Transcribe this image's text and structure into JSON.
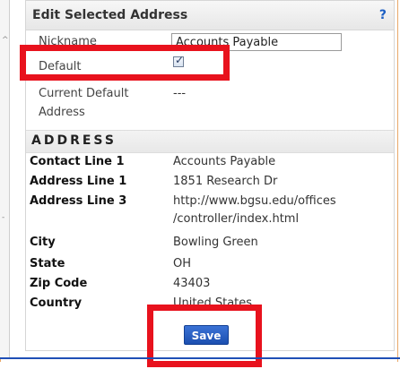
{
  "panel": {
    "title": "Edit Selected Address",
    "help": "?"
  },
  "fields": {
    "nickname_label": "Nickname",
    "nickname_value": "Accounts Payable",
    "default_label": "Default",
    "default_checked": true,
    "current_default_label_line1": "Current Default",
    "current_default_label_line2": "Address",
    "current_default_value": "---"
  },
  "address": {
    "section_title": "ADDRESS",
    "contact_line1_label": "Contact Line 1",
    "contact_line1_value": "Accounts Payable",
    "address_line1_label": "Address Line 1",
    "address_line1_value": "1851 Research Dr",
    "address_line3_label": "Address Line 3",
    "address_line3_value_line1": "http://www.bgsu.edu/offices",
    "address_line3_value_line2": "/controller/index.html",
    "city_label": "City",
    "city_value": "Bowling Green",
    "state_label": "State",
    "state_value": "OH",
    "zip_label": "Zip Code",
    "zip_value": "43403",
    "country_label": "Country",
    "country_value": "United States"
  },
  "actions": {
    "save_label": "Save"
  },
  "colors": {
    "annotation": "#e8121d",
    "button": "#1c4fb0",
    "frame": "#e9a869"
  }
}
